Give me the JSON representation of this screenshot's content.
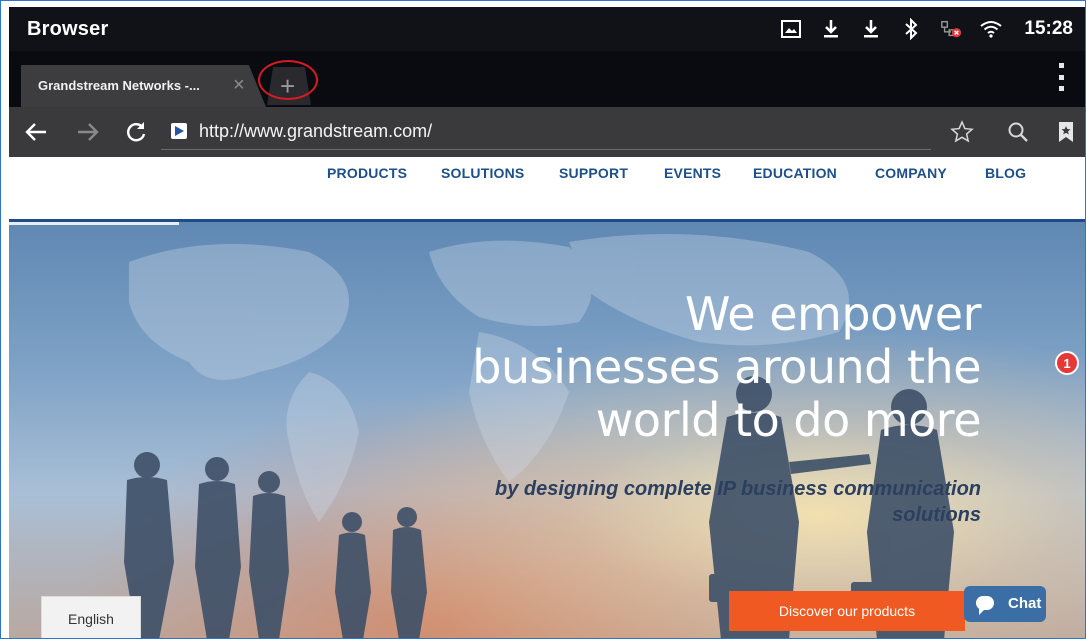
{
  "status_bar": {
    "app_title": "Browser",
    "time": "15:28",
    "icons": [
      "screenshot-icon",
      "download-icon",
      "download-icon",
      "bluetooth-icon",
      "network-error-icon",
      "wifi-icon"
    ]
  },
  "tabs": {
    "active_tab_label": "Grandstream Networks -...",
    "close_glyph": "×",
    "new_tab_glyph": "+"
  },
  "url_bar": {
    "url": "http://www.grandstream.com/"
  },
  "site_nav": {
    "items": [
      "PRODUCTS",
      "SOLUTIONS",
      "SUPPORT",
      "EVENTS",
      "EDUCATION",
      "COMPANY",
      "BLOG"
    ]
  },
  "hero": {
    "headline_line1": "We empower",
    "headline_line2": "businesses around the",
    "headline_line3": "world to do more",
    "subline_line1": "by designing complete IP business communication",
    "subline_line2": "solutions"
  },
  "buttons": {
    "language": "English",
    "cta": "Discover our products",
    "chat": "Chat",
    "chat_badge": "1"
  },
  "colors": {
    "accent_orange": "#f05a22",
    "nav_blue": "#1d4f8a",
    "highlight_red": "#d81b23"
  }
}
